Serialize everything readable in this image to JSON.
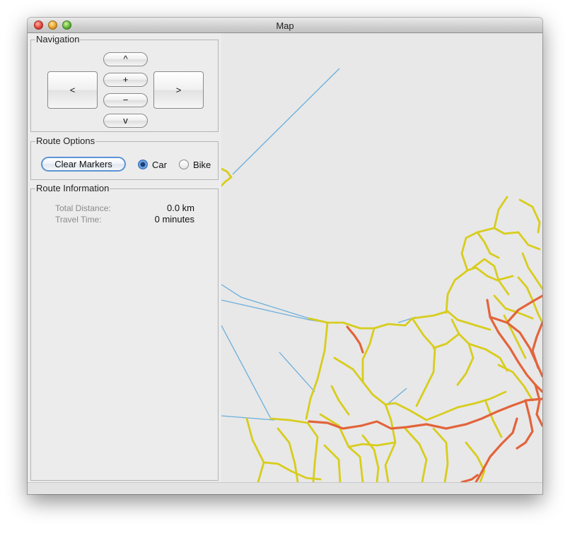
{
  "window": {
    "title": "Map"
  },
  "navigation": {
    "label": "Navigation",
    "up": "^",
    "zoom_in": "+",
    "zoom_out": "−",
    "down": "v",
    "left": "<",
    "right": ">"
  },
  "route_options": {
    "label": "Route Options",
    "clear_button": "Clear Markers",
    "modes": [
      {
        "label": "Car",
        "selected": true
      },
      {
        "label": "Bike",
        "selected": false
      }
    ]
  },
  "route_info": {
    "label": "Route Information",
    "total_distance_label": "Total Distance:",
    "total_distance_value": "0.0 km",
    "travel_time_label": "Travel Time:",
    "travel_time_value": "0 minutes"
  },
  "colors": {
    "minor_road": "#d8cc1c",
    "major_road": "#e2643a",
    "water_line": "#6aaedc",
    "map_background": "#e8e8e8"
  }
}
